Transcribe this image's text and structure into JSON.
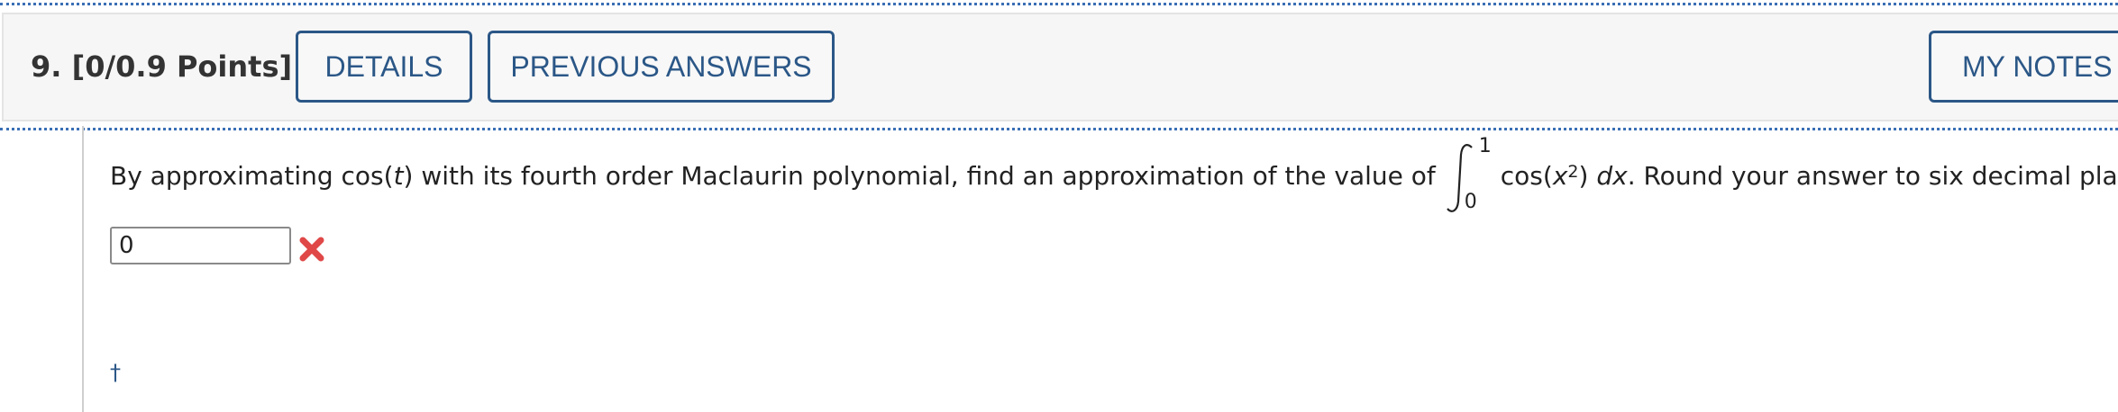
{
  "header": {
    "question_label": "9.  [0/0.9 Points]",
    "details_label": "DETAILS",
    "previous_answers_label": "PREVIOUS ANSWERS",
    "my_notes_label": "MY NOTES"
  },
  "question": {
    "text_before": "By approximating cos(",
    "var_t": "t",
    "text_middle": ") with its fourth order Maclaurin polynomial, find an approximation of the value of",
    "integral_upper": "1",
    "integral_lower": "0",
    "integrand_a": "cos(",
    "integrand_x": "x",
    "integrand_exp": "2",
    "integrand_b": ")",
    "dx": "dx",
    "text_after": ". Round your answer to six decimal places."
  },
  "answer": {
    "value": "0",
    "status": "incorrect",
    "status_icon": "red-x-icon"
  },
  "footnote": {
    "dagger": "†"
  },
  "colors": {
    "accent": "#2b5787",
    "dotted_rule": "#3a6fb5",
    "wrong": "#e04848"
  }
}
